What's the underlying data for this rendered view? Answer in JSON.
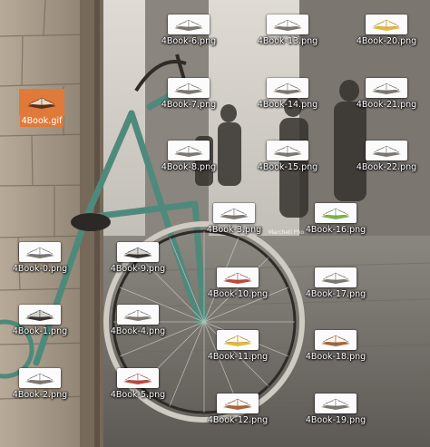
{
  "desktop": {
    "icons": [
      {
        "label": "4Book.gif",
        "selected": true,
        "thumb": "book-gif"
      },
      {
        "label": "4Book-0.png",
        "thumb": "book-white"
      },
      {
        "label": "4Book-1.png",
        "thumb": "book-dark"
      },
      {
        "label": "4Book-2.png",
        "thumb": "book-white"
      },
      {
        "label": "4Book-3.png",
        "thumb": "book-white"
      },
      {
        "label": "4Book-4.png",
        "thumb": "book-white"
      },
      {
        "label": "4Book-5.png",
        "thumb": "book-red"
      },
      {
        "label": "4Book-6.png",
        "thumb": "book-white"
      },
      {
        "label": "4Book-7.png",
        "thumb": "book-white"
      },
      {
        "label": "4Book-8.png",
        "thumb": "book-white"
      },
      {
        "label": "4Book-9.png",
        "thumb": "book-dark"
      },
      {
        "label": "4Book-10.png",
        "thumb": "book-red"
      },
      {
        "label": "4Book-11.png",
        "thumb": "book-yellow"
      },
      {
        "label": "4Book-12.png",
        "thumb": "book-brown"
      },
      {
        "label": "4Book-13.png",
        "thumb": "book-white"
      },
      {
        "label": "4Book-14.png",
        "thumb": "book-white"
      },
      {
        "label": "4Book-15.png",
        "thumb": "book-white"
      },
      {
        "label": "4Book-16.png",
        "thumb": "book-green"
      },
      {
        "label": "4Book-17.png",
        "thumb": "book-white"
      },
      {
        "label": "4Book-18.png",
        "thumb": "book-brown"
      },
      {
        "label": "4Book-19.png",
        "thumb": "book-white"
      },
      {
        "label": "4Book-20.png",
        "thumb": "book-yellow"
      },
      {
        "label": "4Book-21.png",
        "thumb": "book-white"
      },
      {
        "label": "4Book-22.png",
        "thumb": "book-white"
      }
    ],
    "watermark": "Marcheti Pho"
  },
  "colors": {
    "selection": "#e07a3a",
    "label_text": "#ffffff",
    "bike_frame": "#4e8a7b"
  }
}
